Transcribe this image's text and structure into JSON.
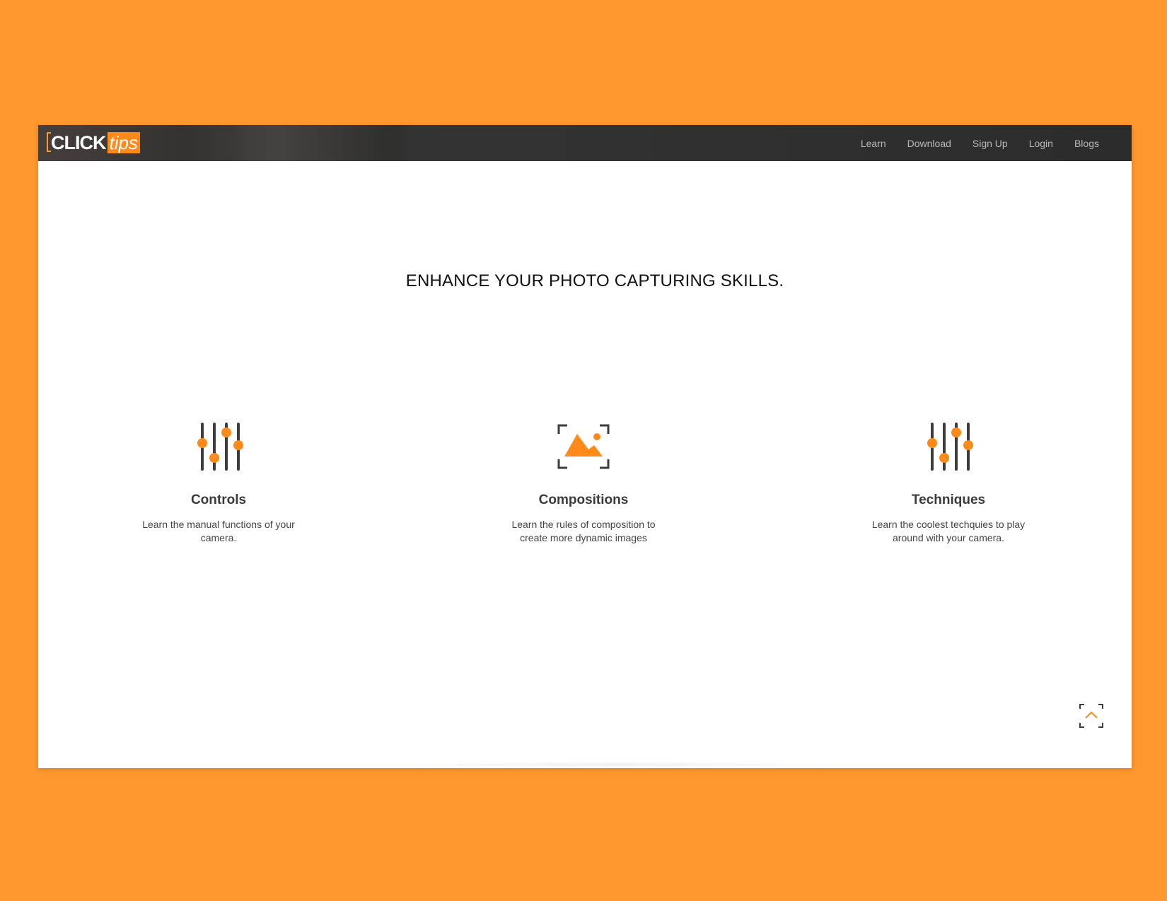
{
  "brand": {
    "logo_main": "CLICK",
    "logo_accent": "tips"
  },
  "nav": {
    "items": [
      {
        "label": "Learn"
      },
      {
        "label": "Download"
      },
      {
        "label": "Sign Up"
      },
      {
        "label": "Login"
      },
      {
        "label": "Blogs"
      }
    ]
  },
  "main": {
    "headline": "ENHANCE YOUR PHOTO CAPTURING SKILLS.",
    "features": [
      {
        "icon": "sliders-icon",
        "title": "Controls",
        "description": "Learn the manual functions of your camera."
      },
      {
        "icon": "image-frame-icon",
        "title": "Compositions",
        "description": "Learn the rules of composition to create more dynamic images"
      },
      {
        "icon": "sliders-icon",
        "title": "Techniques",
        "description": "Learn the coolest techquies to play around with your camera."
      }
    ]
  },
  "scroll_top": {
    "icon": "chevron-up-icon"
  },
  "colors": {
    "accent": "#ff8a1a",
    "background": "#ff962e",
    "navbar": "#2c2c2c",
    "icon_dark": "#3d3d3d"
  }
}
